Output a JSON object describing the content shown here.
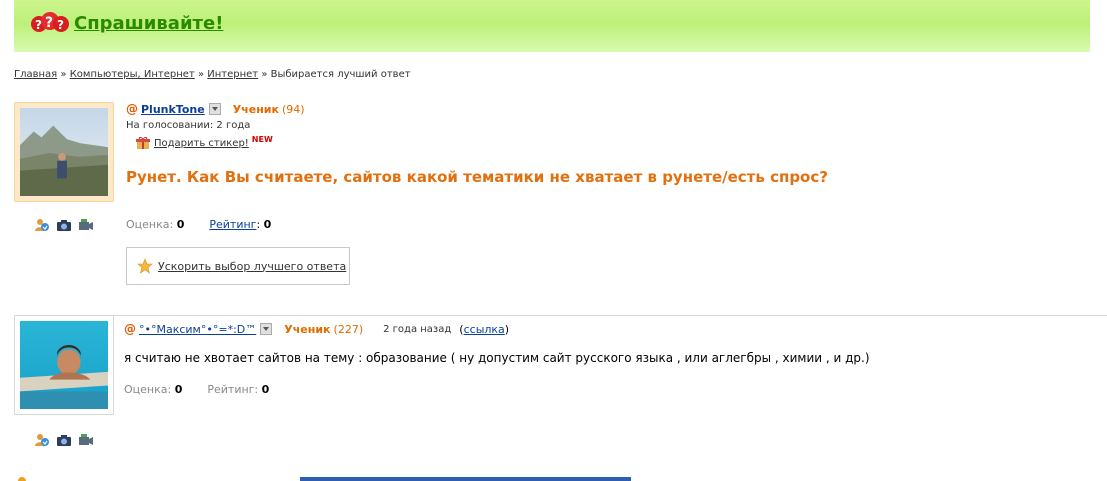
{
  "header": {
    "logo_text": "Спрашивайте!"
  },
  "breadcrumb": {
    "items": [
      "Главная",
      "Компьютеры, Интернет",
      "Интернет"
    ],
    "separator": "»",
    "current": "Выбирается лучший ответ"
  },
  "question": {
    "author": "PlunkTone",
    "rank": "Ученик",
    "rank_count": "(94)",
    "status": "На голосовании: 2 года",
    "gift_label": "Подарить стикер!",
    "gift_new": "NEW",
    "title": "Рунет. Как Вы считаете, сайтов какой тематики не хватает в рунете/есть спрос?",
    "rating_label": "Оценка:",
    "rating_value": "0",
    "score_label": "Рейтинг",
    "score_value": "0",
    "speed_label": "Ускорить выбор лучшего ответа"
  },
  "answer": {
    "author": "°•°Максим°•°=*:D™",
    "rank": "Ученик",
    "rank_count": "(227)",
    "time": "2 года назад",
    "link_label": "ссылка",
    "text": "я считаю не хвотает сайтов на тему : образование ( ну допустим сайт русского языка , или аглегбры , химии , и др.)",
    "rating_label": "Оценка:",
    "rating_value": "0",
    "score_label": "Рейтинг:",
    "score_value": "0"
  },
  "colors": {
    "header_green": "#bdf07a",
    "logo_green": "#2a8a00",
    "rank_orange": "#e26b00",
    "title_orange": "#e2700f",
    "link_blue": "#0b3f96"
  },
  "icons": {
    "logo": "question-marks-icon",
    "user": "user-profile-icon",
    "photo": "camera-icon",
    "video": "video-camera-icon",
    "gift": "gift-icon",
    "star": "star-icon",
    "dropdown": "chevron-down-icon"
  }
}
